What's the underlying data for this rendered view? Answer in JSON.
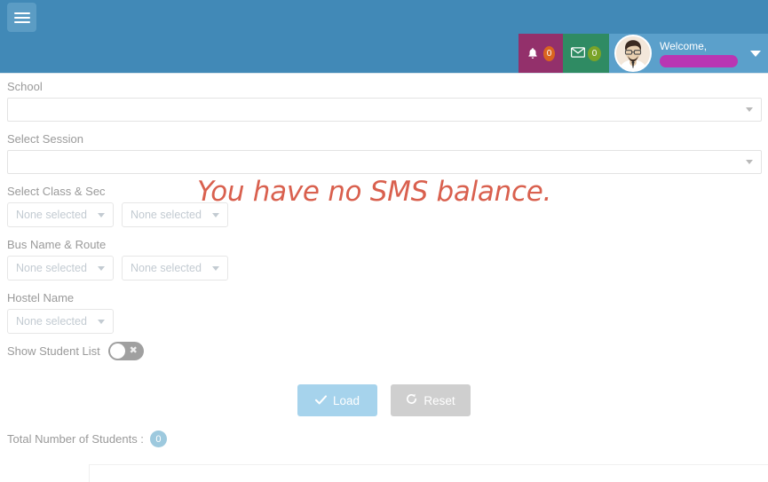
{
  "header": {
    "menu_toggle_name": "menu-toggle",
    "notifications": {
      "icon": "bell-icon",
      "count": "0"
    },
    "messages": {
      "icon": "envelope-icon",
      "count": "0"
    },
    "user": {
      "avatar_alt": "user-avatar",
      "welcome_label": "Welcome,",
      "name_redacted": "",
      "dropdown_icon": "chevron-down-icon"
    },
    "colors": {
      "topbar": "#4189b7",
      "notification_block": "#93306b",
      "message_block": "#2f8b63",
      "user_block": "#5ba0cb",
      "badge_notifications": "#d9641f",
      "badge_messages": "#7aa328",
      "redaction": "#b936b3"
    }
  },
  "notice": {
    "text": "You have no SMS balance.",
    "color": "#d9604e"
  },
  "form": {
    "school": {
      "label": "School",
      "value": "",
      "placeholder": "",
      "dropdown_icon": "chevron-down-icon"
    },
    "session": {
      "label": "Select Session",
      "value": "",
      "placeholder": "",
      "dropdown_icon": "chevron-down-icon"
    },
    "class_sec": {
      "label": "Select Class & Sec",
      "selects": [
        {
          "value": "None selected",
          "caret_icon": "caret-down-icon"
        },
        {
          "value": "None selected",
          "caret_icon": "caret-down-icon"
        }
      ]
    },
    "bus_route": {
      "label": "Bus Name & Route",
      "selects": [
        {
          "value": "None selected",
          "caret_icon": "caret-down-icon"
        },
        {
          "value": "None selected",
          "caret_icon": "caret-down-icon"
        }
      ]
    },
    "hostel": {
      "label": "Hostel Name",
      "selects": [
        {
          "value": "None selected",
          "caret_icon": "caret-down-icon"
        }
      ]
    },
    "show_student_list": {
      "label": "Show Student List",
      "state": "off",
      "off_icon": "cross-icon"
    },
    "buttons": {
      "load": {
        "label": "Load",
        "icon": "check-icon",
        "color": "#a6d3ec"
      },
      "reset": {
        "label": "Reset",
        "icon": "refresh-icon",
        "color": "#cfcfcf"
      }
    }
  },
  "summary": {
    "total_label": "Total Number of Students :",
    "total_count": "0",
    "badge_color": "#9dc9de"
  }
}
